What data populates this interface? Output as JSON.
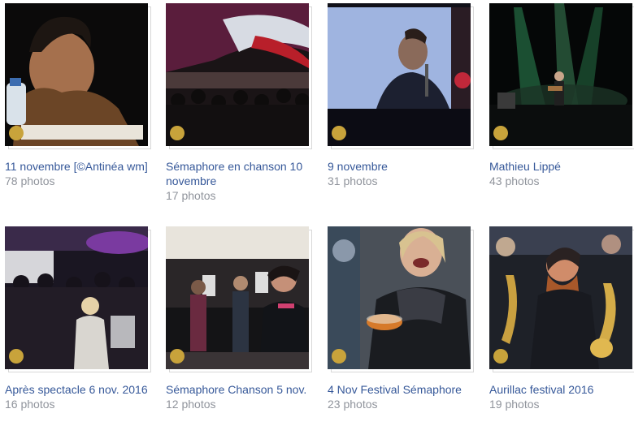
{
  "albums": [
    {
      "title": "11 novembre [©Antinéa wm]",
      "count": "78 photos",
      "thumb_icon": "woman-portrait-photo"
    },
    {
      "title": "Sémaphore en chanson 10 novembre",
      "count": "17 photos",
      "thumb_icon": "crowd-under-tent-photo"
    },
    {
      "title": "9 novembre",
      "count": "31 photos",
      "thumb_icon": "projection-screen-singer-photo"
    },
    {
      "title": "Mathieu Lippé",
      "count": "43 photos",
      "thumb_icon": "concert-stage-green-lights-photo"
    },
    {
      "title": "Après spectacle 6 nov. 2016",
      "count": "16 photos",
      "thumb_icon": "crowd-in-hall-photo"
    },
    {
      "title": "Sémaphore Chanson 5 nov.",
      "count": "12 photos",
      "thumb_icon": "people-talking-in-room-photo"
    },
    {
      "title": "4 Nov Festival Sémaphore",
      "count": "23 photos",
      "thumb_icon": "laughing-woman-with-bowl-photo"
    },
    {
      "title": "Aurillac festival 2016",
      "count": "19 photos",
      "thumb_icon": "brass-band-saxophones-photo"
    }
  ]
}
